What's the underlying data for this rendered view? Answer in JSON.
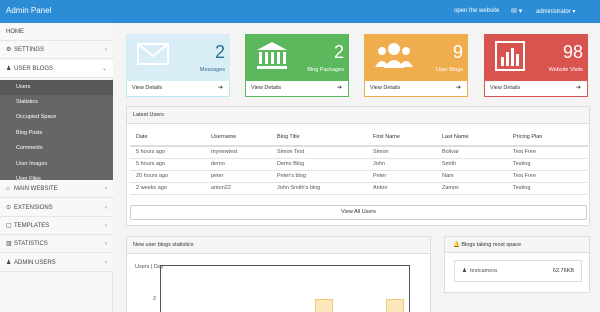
{
  "topbar": {
    "brand": "Admin Panel",
    "link": "open the website",
    "user": "administrator ▾"
  },
  "sidebar": {
    "items": [
      {
        "label": "HOME"
      },
      {
        "label": "SETTINGS"
      },
      {
        "label": "USER BLOGS"
      },
      {
        "label": "MAIN WEBSITE"
      },
      {
        "label": "EXTENSIONS"
      },
      {
        "label": "TEMPLATES"
      },
      {
        "label": "STATISTICS"
      },
      {
        "label": "ADMIN USERS"
      }
    ],
    "submenu": [
      {
        "label": "Users"
      },
      {
        "label": "Statistics"
      },
      {
        "label": "Occupied Space"
      },
      {
        "label": "Blog Posts"
      },
      {
        "label": "Comments"
      },
      {
        "label": "User Images"
      },
      {
        "label": "User Files"
      }
    ]
  },
  "cards": [
    {
      "number": "2",
      "caption": "Messages",
      "footer": "View Details",
      "color": "#d9edf7",
      "border": "#bce8f1",
      "textColor": "#31708f"
    },
    {
      "number": "2",
      "caption": "Blog Packages",
      "footer": "View Details",
      "color": "#5cb85c",
      "border": "#5cb85c",
      "textColor": "#333"
    },
    {
      "number": "9",
      "caption": "User Blogs",
      "footer": "View Details",
      "color": "#f0ad4e",
      "border": "#f0ad4e",
      "textColor": "#333"
    },
    {
      "number": "98",
      "caption": "Website Visits",
      "footer": "View Details",
      "color": "#d9534f",
      "border": "#d9534f",
      "textColor": "#333"
    }
  ],
  "latest": {
    "title": "Latest Users",
    "headers": [
      "Date",
      "Username",
      "Blog Title",
      "First Name",
      "Last Name",
      "Pricing Plan"
    ],
    "rows": [
      [
        "5 hours ago",
        "mynewtest",
        "Simon Test",
        "Simon",
        "Bolivar",
        "Test Free"
      ],
      [
        "5 hours ago",
        "demo",
        "Demo Blog",
        "John",
        "Smith",
        "Testing"
      ],
      [
        "20 hours ago",
        "peter",
        "Peter's blog",
        "Peter",
        "Nam",
        "Test Free"
      ],
      [
        "2 weeks ago",
        "anton22",
        "John Smith's blog",
        "Anton",
        "Zamov",
        "Testing"
      ]
    ],
    "viewall": "View All Users"
  },
  "stats": {
    "title": "New user blogs statistics",
    "ylabel": "Users | Day",
    "ytick": "2"
  },
  "space": {
    "title": "Blogs taking most space",
    "user": "testcamera",
    "size": "62.76KB"
  }
}
